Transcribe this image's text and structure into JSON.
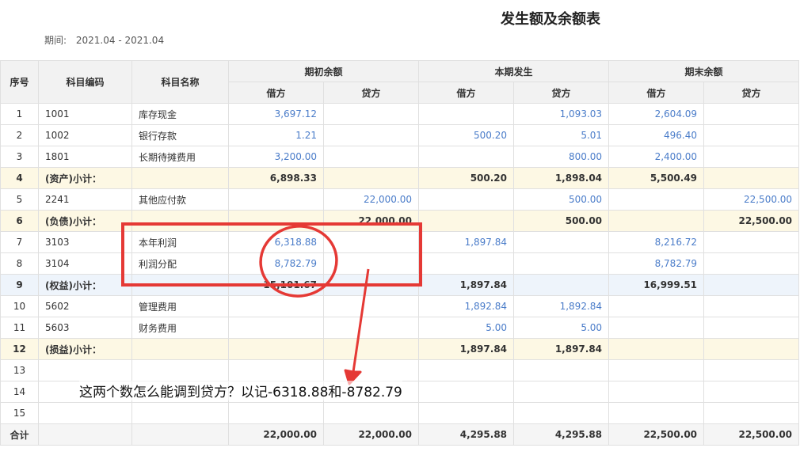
{
  "title": "发生额及余额表",
  "period": {
    "label": "期间:",
    "value": "2021.04 - 2021.04"
  },
  "headers": {
    "seq": "序号",
    "code": "科目编码",
    "name": "科目名称",
    "opening": "期初余额",
    "current": "本期发生",
    "closing": "期末余额",
    "debit": "借方",
    "credit": "贷方"
  },
  "rows": [
    {
      "seq": "1",
      "code": "1001",
      "name": "库存现金",
      "od": "3,697.12",
      "oc": "",
      "cd": "",
      "cc": "1,093.03",
      "ed": "2,604.09",
      "ec": ""
    },
    {
      "seq": "2",
      "code": "1002",
      "name": "银行存款",
      "od": "1.21",
      "oc": "",
      "cd": "500.20",
      "cc": "5.01",
      "ed": "496.40",
      "ec": ""
    },
    {
      "seq": "3",
      "code": "1801",
      "name": "长期待摊费用",
      "od": "3,200.00",
      "oc": "",
      "cd": "",
      "cc": "800.00",
      "ed": "2,400.00",
      "ec": ""
    },
    {
      "seq": "4",
      "code": "(资产)小计：",
      "name": "",
      "od": "6,898.33",
      "oc": "",
      "cd": "500.20",
      "cc": "1,898.04",
      "ed": "5,500.49",
      "ec": ""
    },
    {
      "seq": "5",
      "code": "2241",
      "name": "其他应付款",
      "od": "",
      "oc": "22,000.00",
      "cd": "",
      "cc": "500.00",
      "ed": "",
      "ec": "22,500.00"
    },
    {
      "seq": "6",
      "code": "(负债)小计：",
      "name": "",
      "od": "",
      "oc": "22,000.00",
      "cd": "",
      "cc": "500.00",
      "ed": "",
      "ec": "22,500.00"
    },
    {
      "seq": "7",
      "code": "3103",
      "name": "本年利润",
      "od": "6,318.88",
      "oc": "",
      "cd": "1,897.84",
      "cc": "",
      "ed": "8,216.72",
      "ec": ""
    },
    {
      "seq": "8",
      "code": "3104",
      "name": "利润分配",
      "od": "8,782.79",
      "oc": "",
      "cd": "",
      "cc": "",
      "ed": "8,782.79",
      "ec": ""
    },
    {
      "seq": "9",
      "code": "(权益)小计：",
      "name": "",
      "od": "15,101.67",
      "oc": "",
      "cd": "1,897.84",
      "cc": "",
      "ed": "16,999.51",
      "ec": ""
    },
    {
      "seq": "10",
      "code": "5602",
      "name": "管理费用",
      "od": "",
      "oc": "",
      "cd": "1,892.84",
      "cc": "1,892.84",
      "ed": "",
      "ec": ""
    },
    {
      "seq": "11",
      "code": "5603",
      "name": "财务费用",
      "od": "",
      "oc": "",
      "cd": "5.00",
      "cc": "5.00",
      "ed": "",
      "ec": ""
    },
    {
      "seq": "12",
      "code": "(损益)小计：",
      "name": "",
      "od": "",
      "oc": "",
      "cd": "1,897.84",
      "cc": "1,897.84",
      "ed": "",
      "ec": ""
    },
    {
      "seq": "13",
      "code": "",
      "name": "",
      "od": "",
      "oc": "",
      "cd": "",
      "cc": "",
      "ed": "",
      "ec": ""
    },
    {
      "seq": "14",
      "code": "",
      "name": "",
      "od": "",
      "oc": "",
      "cd": "",
      "cc": "",
      "ed": "",
      "ec": ""
    },
    {
      "seq": "15",
      "code": "",
      "name": "",
      "od": "",
      "oc": "",
      "cd": "",
      "cc": "",
      "ed": "",
      "ec": ""
    }
  ],
  "total": {
    "label": "合计",
    "od": "22,000.00",
    "oc": "22,000.00",
    "cd": "4,295.88",
    "cc": "4,295.88",
    "ed": "22,500.00",
    "ec": "22,500.00"
  },
  "annotation": {
    "note": "这两个数怎么能调到贷方？以记-6318.88和-8782.79",
    "color": "#e53935"
  }
}
